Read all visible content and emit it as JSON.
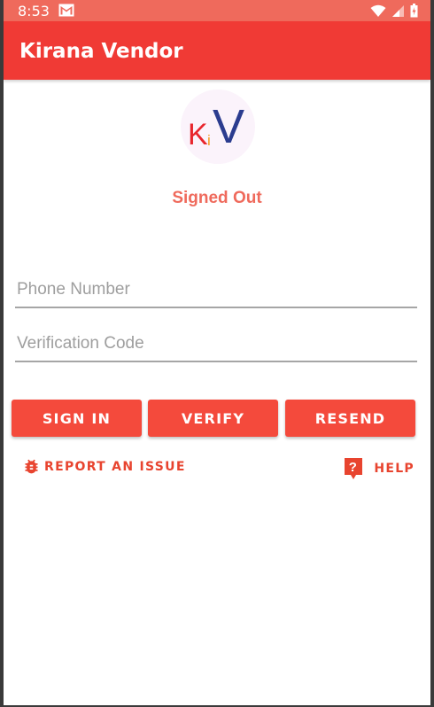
{
  "status_bar": {
    "time": "8:53",
    "notification_icon": "gmail-icon",
    "right_icons": [
      "wifi-icon",
      "signal-icon",
      "battery-icon"
    ]
  },
  "app_bar": {
    "title": "Kirana Vendor",
    "color": "#f03a35"
  },
  "logo": {
    "letters": [
      "K",
      "i",
      "V"
    ]
  },
  "auth": {
    "status": "Signed Out"
  },
  "form": {
    "phone_placeholder": "Phone Number",
    "phone_value": "",
    "code_placeholder": "Verification Code",
    "code_value": ""
  },
  "buttons": {
    "sign_in": "SIGN IN",
    "verify": "VERIFY",
    "resend": "RESEND"
  },
  "links": {
    "report_issue": "REPORT AN ISSUE",
    "help": "HELP"
  },
  "colors": {
    "accent": "#f44a3c",
    "status_text": "#ef6a5c"
  }
}
